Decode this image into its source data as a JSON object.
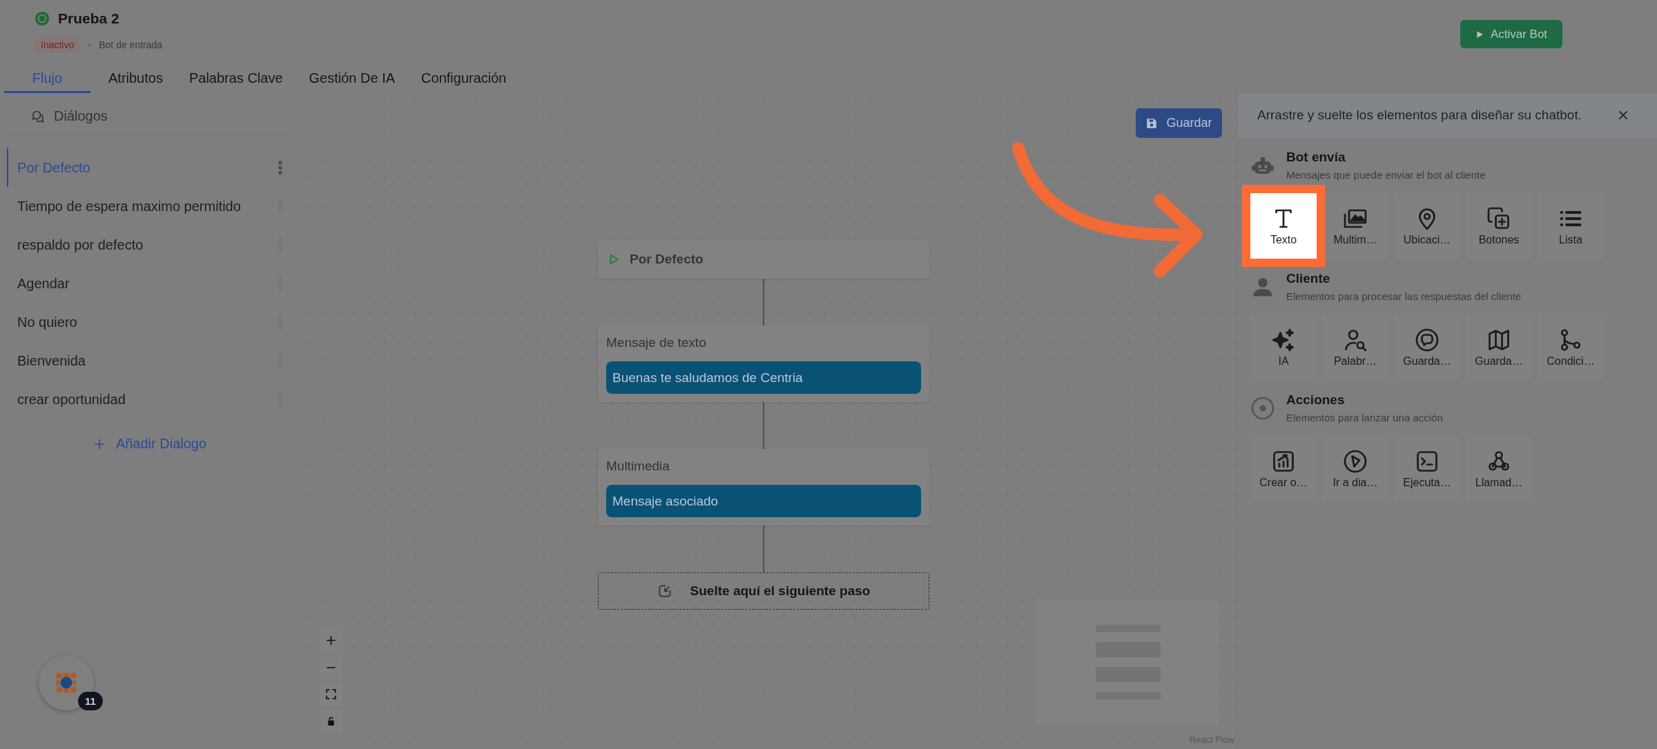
{
  "bot": {
    "name": "Prueba 2",
    "status": "Inactivo",
    "type": "Bot de entrada",
    "activate_button": "Activar Bot"
  },
  "tabs": [
    {
      "label": "Flujo",
      "selected": true
    },
    {
      "label": "Atributos",
      "selected": false
    },
    {
      "label": "Palabras Clave",
      "selected": false
    },
    {
      "label": "Gestión De IA",
      "selected": false
    },
    {
      "label": "Configuración",
      "selected": false
    }
  ],
  "sidebar": {
    "title": "Diálogos",
    "items": [
      {
        "label": "Por Defecto",
        "selected": true
      },
      {
        "label": "Tiempo de espera maximo permitido",
        "selected": false
      },
      {
        "label": "respaldo por defecto",
        "selected": false
      },
      {
        "label": "Agendar",
        "selected": false
      },
      {
        "label": "No quiero",
        "selected": false
      },
      {
        "label": "Bienvenida",
        "selected": false
      },
      {
        "label": "crear oportunidad",
        "selected": false
      }
    ],
    "add_button": "Añadir Dialogo"
  },
  "canvas": {
    "save_button": "Guardar",
    "nodes": [
      {
        "kind": "start",
        "title": "Por Defecto"
      },
      {
        "kind": "message",
        "title": "Mensaje de texto",
        "message": "Buenas te saludamos de Centria"
      },
      {
        "kind": "message",
        "title": "Multimedia",
        "message": "Mensaje asociado"
      },
      {
        "kind": "drop",
        "title": "Suelte aquí el siguiente paso"
      }
    ],
    "attribution": "React Flow"
  },
  "palette": {
    "hint": "Arrastre y suelte los elementos para diseñar su chatbot.",
    "sections": [
      {
        "title": "Bot envía",
        "subtitle": "Mensajes que puede enviar el bot al cliente",
        "items": [
          {
            "label": "Texto",
            "highlighted": true
          },
          {
            "label": "Multim…",
            "highlighted": false
          },
          {
            "label": "Ubicaci…",
            "highlighted": false
          },
          {
            "label": "Botones",
            "highlighted": false
          },
          {
            "label": "Lista",
            "highlighted": false
          }
        ]
      },
      {
        "title": "Cliente",
        "subtitle": "Elementos para procesar las respuestas del cliente",
        "items": [
          {
            "label": "IA",
            "highlighted": false
          },
          {
            "label": "Palabr…",
            "highlighted": false
          },
          {
            "label": "Guarda…",
            "highlighted": false
          },
          {
            "label": "Guarda…",
            "highlighted": false
          },
          {
            "label": "Condici…",
            "highlighted": false
          }
        ]
      },
      {
        "title": "Acciones",
        "subtitle": "Elementos para lanzar una acción",
        "items": [
          {
            "label": "Crear o…",
            "highlighted": false
          },
          {
            "label": "Ir a dia…",
            "highlighted": false
          },
          {
            "label": "Ejecuta…",
            "highlighted": false
          },
          {
            "label": "Llamad…",
            "highlighted": false
          }
        ]
      }
    ]
  },
  "chat_widget": {
    "badge": "11"
  }
}
